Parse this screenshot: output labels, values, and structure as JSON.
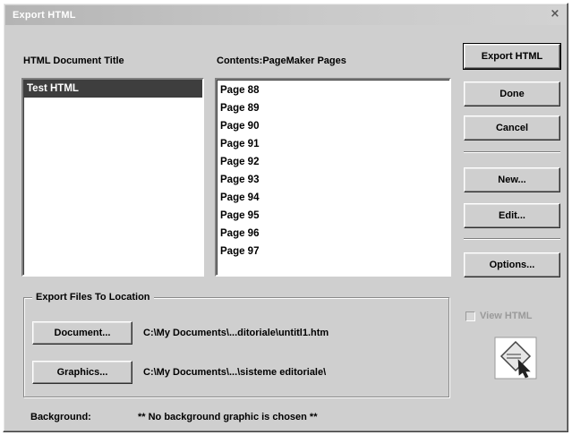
{
  "window": {
    "title": "Export HTML",
    "close_glyph": "×"
  },
  "left_list": {
    "label": "HTML Document Title",
    "items": [
      "Test HTML"
    ],
    "selected": "Test HTML"
  },
  "right_list": {
    "label": "Contents:PageMaker Pages",
    "items": [
      "Page 88",
      "Page 89",
      "Page 90",
      "Page 91",
      "Page 92",
      "Page 93",
      "Page 94",
      "Page 95",
      "Page 96",
      "Page 97"
    ]
  },
  "buttons": {
    "export_html": "Export HTML",
    "done": "Done",
    "cancel": "Cancel",
    "new": "New...",
    "edit": "Edit...",
    "options": "Options..."
  },
  "export_location": {
    "group_label": "Export Files To Location",
    "document_button": "Document...",
    "document_path": "C:\\My Documents\\...ditoriale\\untitl1.htm",
    "graphics_button": "Graphics...",
    "graphics_path": "C:\\My Documents\\...\\sisteme editoriale\\"
  },
  "view_html": {
    "label": "View HTML",
    "checked": false,
    "enabled": false
  },
  "background": {
    "label": "Background:",
    "value": "** No background graphic is chosen **"
  },
  "icons": {
    "close": "close-icon",
    "view_html": "html-document-icon",
    "checkbox": "checkbox-icon"
  },
  "colors": {
    "dialog_bg": "#cfcfcf",
    "selection_bg": "#3e3e3e",
    "titlebar": "#bdbdbd"
  }
}
